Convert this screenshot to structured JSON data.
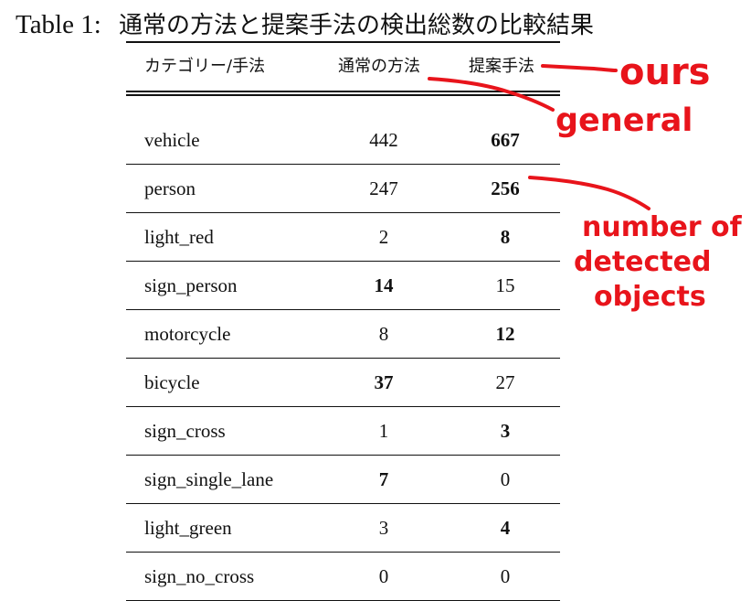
{
  "caption": {
    "label": "Table 1:",
    "title": "通常の方法と提案手法の検出総数の比較結果"
  },
  "table": {
    "headers": [
      "カテゴリー/手法",
      "通常の方法",
      "提案手法"
    ],
    "rows": [
      {
        "name": "vehicle",
        "general": "442",
        "ours": "667",
        "bold": "ours"
      },
      {
        "name": "person",
        "general": "247",
        "ours": "256",
        "bold": "ours"
      },
      {
        "name": "light_red",
        "general": "2",
        "ours": "8",
        "bold": "ours"
      },
      {
        "name": "sign_person",
        "general": "14",
        "ours": "15",
        "bold": "general"
      },
      {
        "name": "motorcycle",
        "general": "8",
        "ours": "12",
        "bold": "ours"
      },
      {
        "name": "bicycle",
        "general": "37",
        "ours": "27",
        "bold": "general"
      },
      {
        "name": "sign_cross",
        "general": "1",
        "ours": "3",
        "bold": "ours"
      },
      {
        "name": "sign_single_lane",
        "general": "7",
        "ours": "0",
        "bold": "general"
      },
      {
        "name": "light_green",
        "general": "3",
        "ours": "4",
        "bold": "ours"
      },
      {
        "name": "sign_no_cross",
        "general": "0",
        "ours": "0",
        "bold": "none"
      }
    ]
  },
  "annotations": {
    "ours": "ours",
    "general": "general",
    "detected": [
      "number of",
      "detected",
      "objects"
    ],
    "ink_color": "#e8141b"
  }
}
